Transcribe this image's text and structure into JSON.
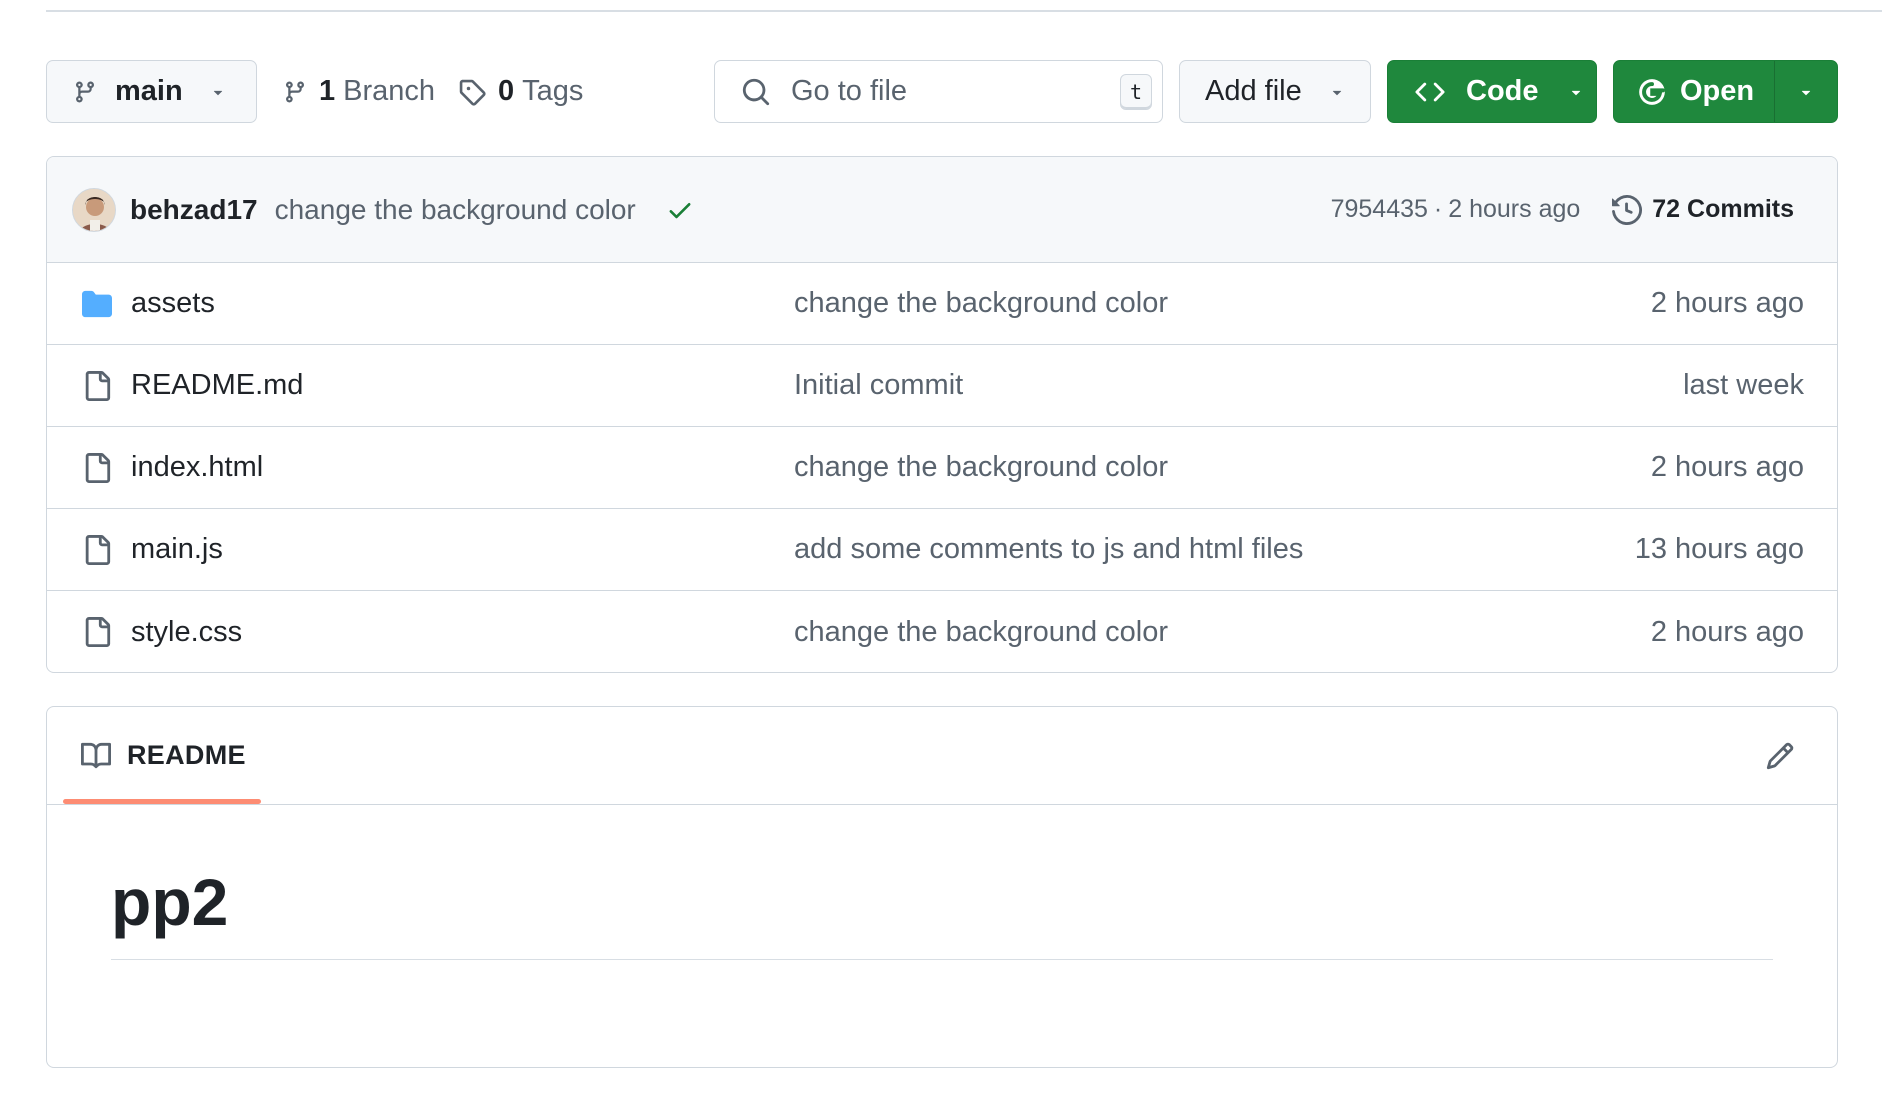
{
  "toolbar": {
    "branch_label": "main",
    "branch_count": "1",
    "branch_word": "Branch",
    "tag_count": "0",
    "tag_word": "Tags",
    "search_placeholder": "Go to file",
    "search_shortcut": "t",
    "add_file_label": "Add file",
    "code_label": "Code",
    "open_label": "Open"
  },
  "latest_commit": {
    "author": "behzad17",
    "message": "change the background color",
    "hash": "7954435",
    "separator": "·",
    "time": "2 hours ago",
    "commits_count_label": "72 Commits"
  },
  "files": [
    {
      "name": "assets",
      "type": "folder",
      "icon": "folder-icon",
      "message": "change the background color",
      "time": "2 hours ago"
    },
    {
      "name": "README.md",
      "type": "file",
      "icon": "file-icon",
      "message": "Initial commit",
      "time": "last week"
    },
    {
      "name": "index.html",
      "type": "file",
      "icon": "file-icon",
      "message": "change the background color",
      "time": "2 hours ago"
    },
    {
      "name": "main.js",
      "type": "file",
      "icon": "file-icon",
      "message": "add some comments to js and html files",
      "time": "13 hours ago"
    },
    {
      "name": "style.css",
      "type": "file",
      "icon": "file-icon",
      "message": "change the background color",
      "time": "2 hours ago"
    }
  ],
  "readme": {
    "tab_label": "README",
    "title": "pp2"
  },
  "colors": {
    "primary_green": "#1f883d",
    "border": "#d0d7de",
    "muted_text": "#59636e",
    "folder_blue": "#54aeff",
    "success_check": "#1a7f37",
    "tab_underline": "#fd8c73"
  }
}
